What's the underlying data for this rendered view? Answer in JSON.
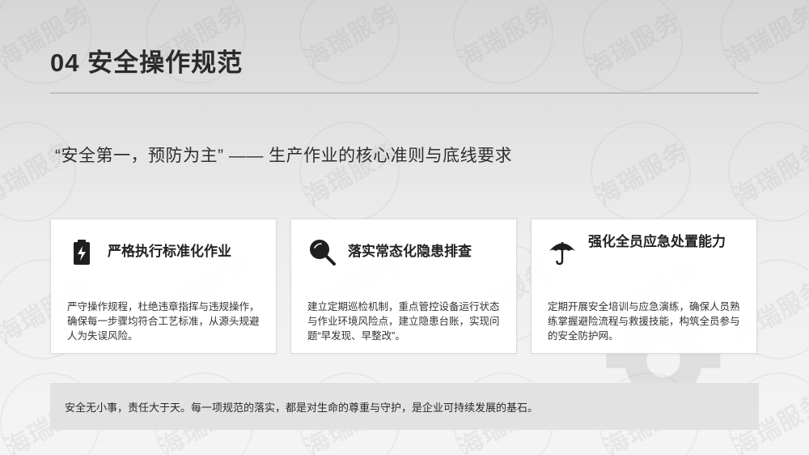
{
  "page": {
    "title": "04 安全操作规范",
    "headline": "“安全第一，预防为主” —— 生产作业的核心准则与底线要求"
  },
  "watermark": {
    "text": "海瑞服务"
  },
  "cards": [
    {
      "icon": "battery-charging-icon",
      "title": "严格执行标准化作业",
      "desc": "严守操作规程，杜绝违章指挥与违规操作，确保每一步骤均符合工艺标准，从源头规避人为失误风险。"
    },
    {
      "icon": "magnifier-icon",
      "title": "落实常态化隐患排查",
      "desc": "建立定期巡检机制，重点管控设备运行状态与作业环境风险点，建立隐患台账，实现问题“早发现、早整改”。"
    },
    {
      "icon": "umbrella-icon",
      "title": "强化全员应急处置能力",
      "desc": "定期开展安全培训与应急演练，确保人员熟练掌握避险流程与救援技能，构筑全员参与的安全防护网。"
    }
  ],
  "footer": {
    "text": "安全无小事，责任大于天。每一项规范的落实，都是对生命的尊重与守护，是企业可持续发展的基石。"
  }
}
